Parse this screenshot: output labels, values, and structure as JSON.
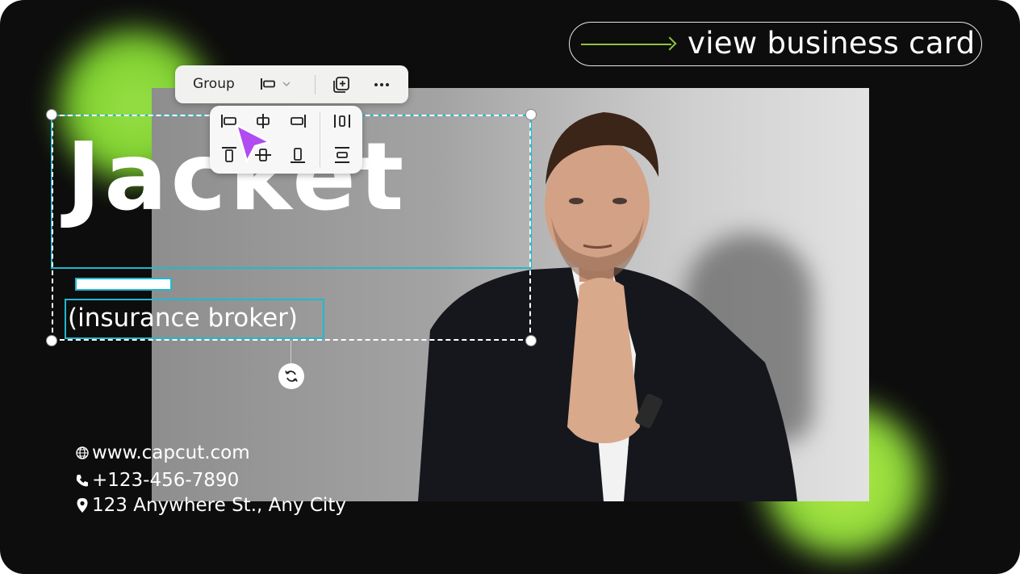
{
  "cta": {
    "label": "view business card"
  },
  "card": {
    "headline": "Jacket",
    "subtitle": "(insurance broker)",
    "contact": [
      {
        "icon": "globe-icon",
        "text": "www.capcut.com"
      },
      {
        "icon": "phone-icon",
        "text": "+123-456-7890"
      },
      {
        "icon": "location-pin-icon",
        "text": "123 Anywhere St., Any City"
      }
    ]
  },
  "toolbar": {
    "group_label": "Group"
  },
  "colors": {
    "background": "#0d0d0d",
    "accent_green": "#8cc63f",
    "selection_cyan": "#22b8cf",
    "cursor_purple": "#b14cf0"
  }
}
